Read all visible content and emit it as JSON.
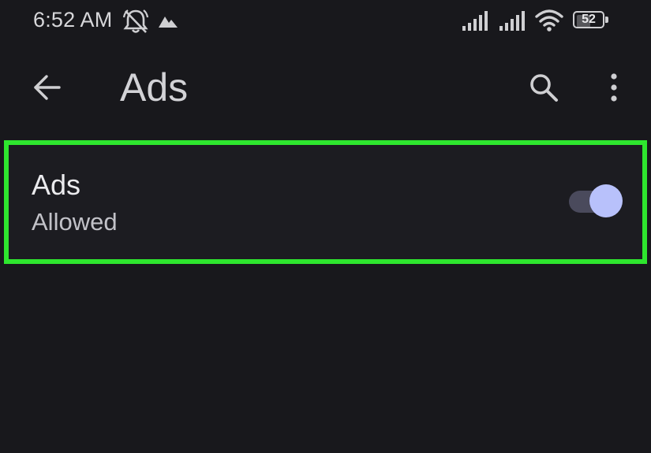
{
  "status_bar": {
    "time": "6:52 AM",
    "battery_level": "52",
    "icons": [
      "bell-off-icon",
      "mountain-icon",
      "signal-icon",
      "signal-icon",
      "wifi-icon",
      "battery-icon"
    ]
  },
  "app_bar": {
    "title": "Ads",
    "icons": [
      "back-arrow-icon",
      "search-icon",
      "more-vertical-icon"
    ]
  },
  "setting": {
    "title": "Ads",
    "subtitle": "Allowed",
    "toggle_on": true
  },
  "colors": {
    "background": "#18181c",
    "highlight_border": "#2ee62e",
    "toggle_thumb": "#b8c1fb",
    "toggle_track": "#4a4a5c"
  }
}
